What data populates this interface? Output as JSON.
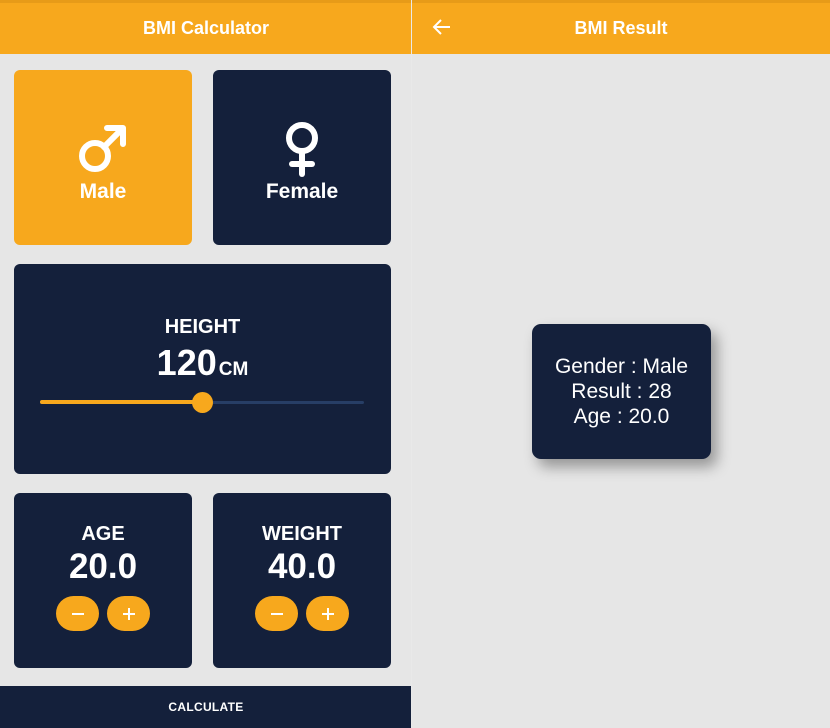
{
  "left_screen": {
    "appbar_title": "BMI Calculator",
    "gender": {
      "male_label": "Male",
      "female_label": "Female",
      "selected": "male"
    },
    "height": {
      "label": "HEIGHT",
      "value": "120",
      "unit": "CM",
      "slider_fraction": 0.5
    },
    "age": {
      "label": "AGE",
      "value": "20.0"
    },
    "weight": {
      "label": "WEIGHT",
      "value": "40.0"
    },
    "calculate_label": "CALCULATE"
  },
  "right_screen": {
    "appbar_title": "BMI Result",
    "back_icon": "arrow-left-icon",
    "result": {
      "gender_line": "Gender : Male",
      "result_line": "Result : 28",
      "age_line": "Age : 20.0"
    }
  },
  "colors": {
    "accent": "#f7a81d",
    "card": "#14203b",
    "background": "#e6e6e6",
    "text": "#ffffff"
  }
}
